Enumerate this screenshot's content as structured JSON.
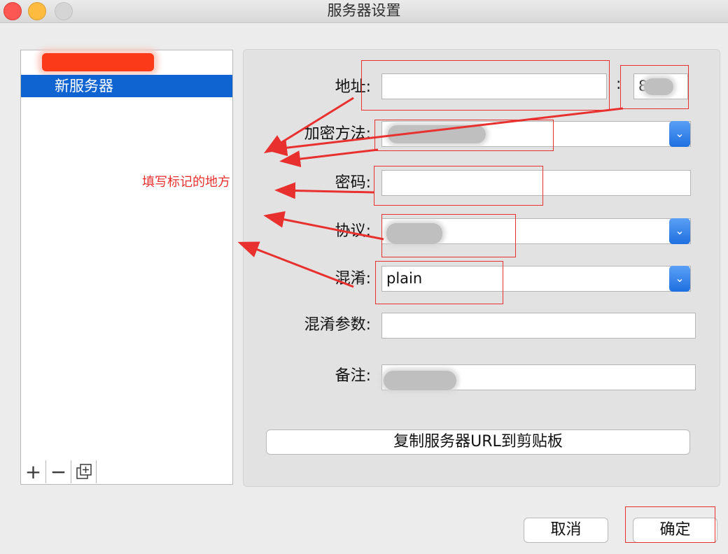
{
  "window": {
    "title": "服务器设置"
  },
  "server_list": {
    "items": [
      {
        "label": "",
        "redacted": true
      },
      {
        "label": "新服务器",
        "selected": true
      }
    ],
    "toolbar": {
      "add_label": "+",
      "remove_label": "−",
      "duplicate_icon": "duplicate-icon"
    }
  },
  "form": {
    "address": {
      "label": "地址:",
      "value": "",
      "port_separator": ":",
      "port_value": "8"
    },
    "encryption": {
      "label": "加密方法:",
      "value": ""
    },
    "password": {
      "label": "密码:",
      "value": ""
    },
    "protocol": {
      "label": "协议:",
      "value": ""
    },
    "obfs": {
      "label": "混淆:",
      "value": "plain"
    },
    "obfs_param": {
      "label": "混淆参数:",
      "value": ""
    },
    "remark": {
      "label": "备注:",
      "value": ""
    },
    "copy_url_label": "复制服务器URL到剪贴板"
  },
  "dialog": {
    "cancel_label": "取消",
    "ok_label": "确定"
  },
  "annotation": {
    "text": "填写标记的地方",
    "color": "#e8302f"
  }
}
